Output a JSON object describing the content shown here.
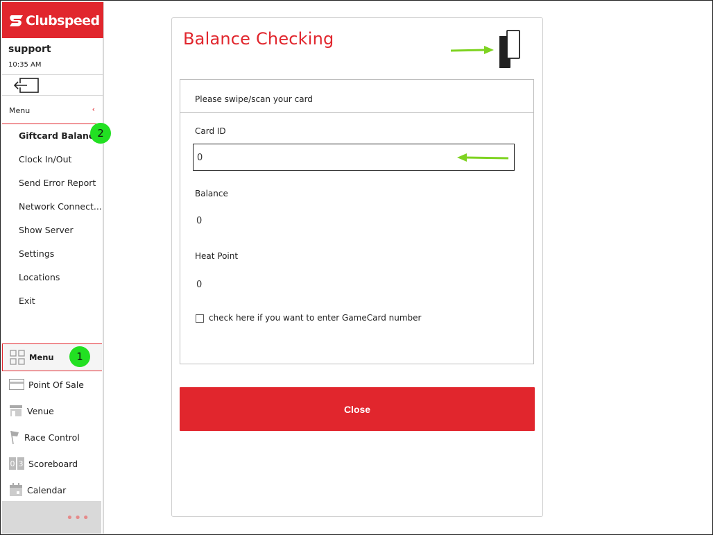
{
  "brand": {
    "name": "Clubspeed",
    "color": "#e1262d"
  },
  "user": {
    "name": "support",
    "time": "10:35 AM"
  },
  "logout_icon": "logout-arrow-icon",
  "menu_header": {
    "label": "Menu",
    "chevron": "‹"
  },
  "submenu": [
    {
      "label": "Giftcard Balance",
      "active": true
    },
    {
      "label": "Clock In/Out"
    },
    {
      "label": "Send Error Report"
    },
    {
      "label": "Network Connect..."
    },
    {
      "label": "Show Server"
    },
    {
      "label": "Settings"
    },
    {
      "label": "Locations"
    },
    {
      "label": "Exit"
    }
  ],
  "nav": [
    {
      "label": "Menu",
      "icon": "grid-icon",
      "active": true
    },
    {
      "label": "Point Of Sale",
      "icon": "credit-card-icon"
    },
    {
      "label": "Venue",
      "icon": "store-icon"
    },
    {
      "label": "Race Control",
      "icon": "flag-icon"
    },
    {
      "label": "Scoreboard",
      "icon": "scoreboard-icon"
    },
    {
      "label": "Calendar",
      "icon": "calendar-icon"
    }
  ],
  "footer": {
    "more": "•••"
  },
  "badges": {
    "one": "1",
    "two": "2",
    "color": "#22e022"
  },
  "dialog": {
    "title": "Balance Checking",
    "instruction": "Please swipe/scan your card",
    "card_id_label": "Card ID",
    "card_id_value": "0",
    "balance_label": "Balance",
    "balance_value": "0",
    "heat_point_label": "Heat Point",
    "heat_point_value": "0",
    "checkbox_label": "check here if you want to enter GameCard number",
    "checkbox_checked": false,
    "close_label": "Close"
  },
  "annotation_color": "#7ed321"
}
